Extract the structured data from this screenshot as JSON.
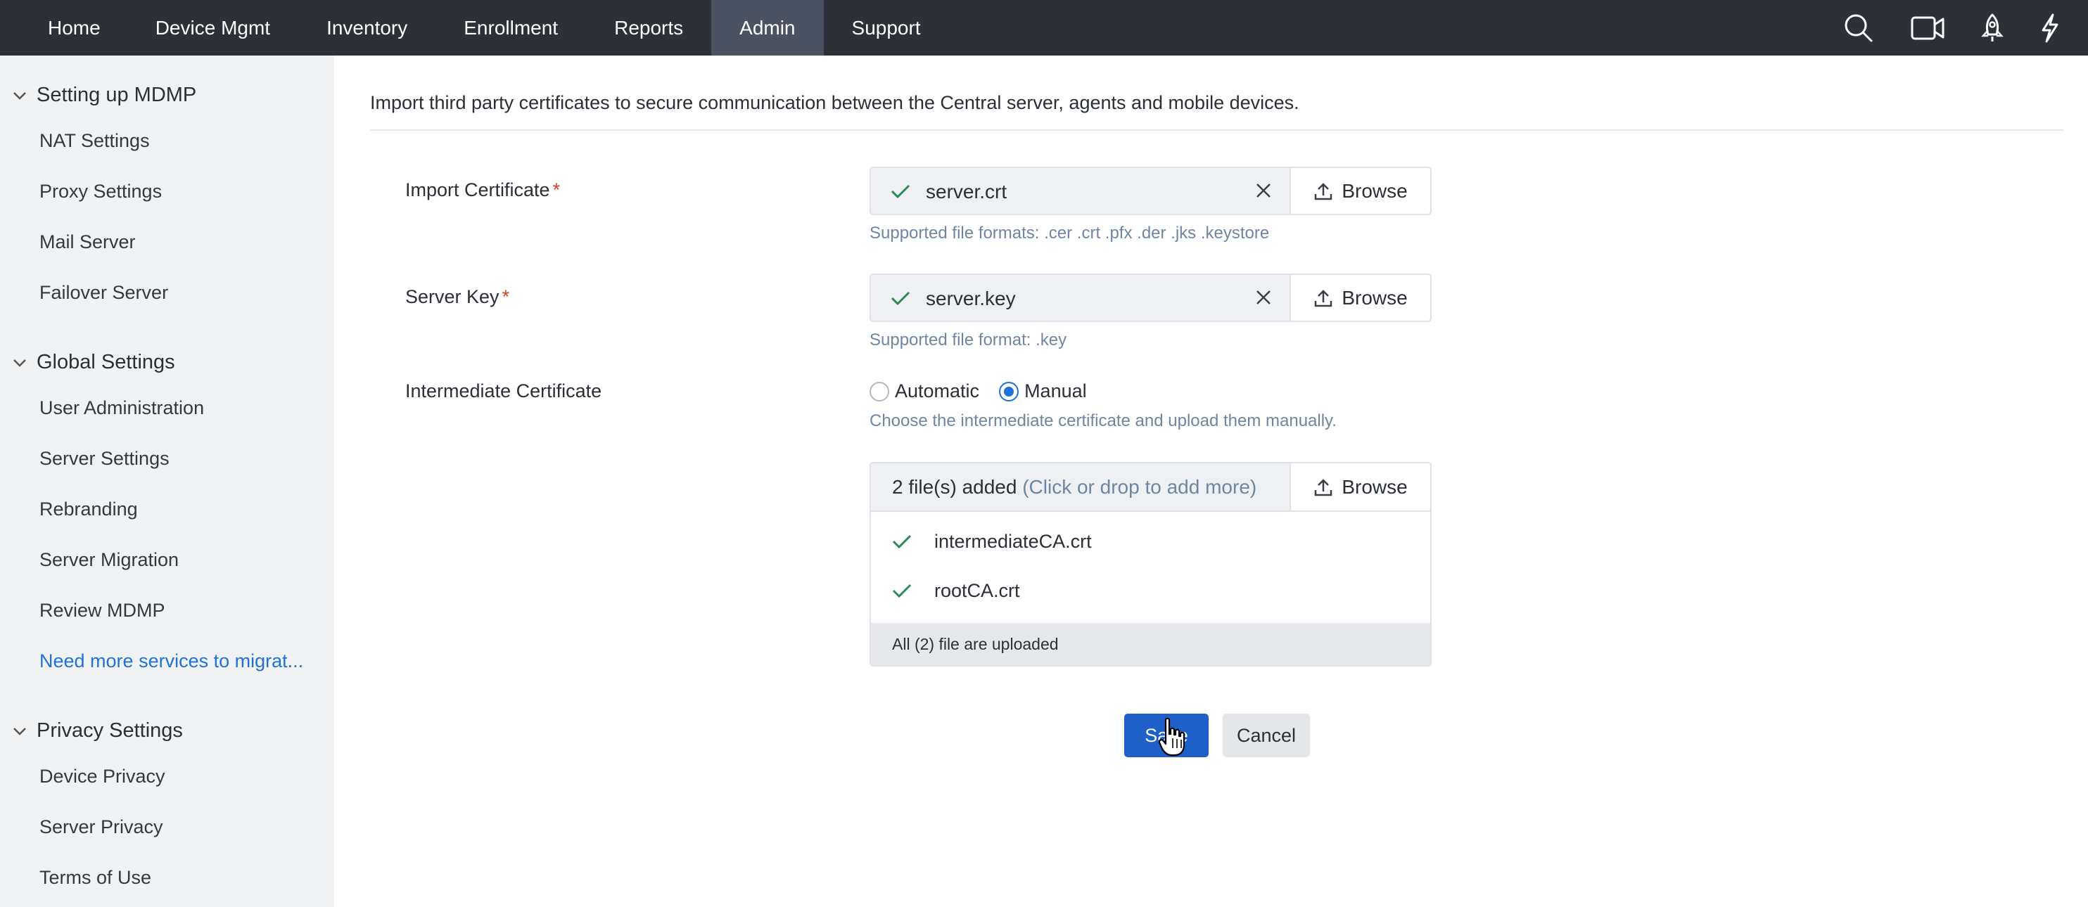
{
  "nav": {
    "items": [
      "Home",
      "Device Mgmt",
      "Inventory",
      "Enrollment",
      "Reports",
      "Admin",
      "Support"
    ],
    "active": "Admin",
    "icons": [
      "search-icon",
      "video-icon",
      "rocket-icon",
      "flash-icon"
    ]
  },
  "sidebar": {
    "groups": [
      {
        "title": "Setting up MDMP",
        "items": [
          "NAT Settings",
          "Proxy Settings",
          "Mail Server",
          "Failover Server"
        ]
      },
      {
        "title": "Global Settings",
        "items": [
          "User Administration",
          "Server Settings",
          "Rebranding",
          "Server Migration",
          "Review MDMP",
          "Need more services to migrat..."
        ]
      },
      {
        "title": "Privacy Settings",
        "items": [
          "Device Privacy",
          "Server Privacy",
          "Terms of Use"
        ]
      }
    ]
  },
  "main": {
    "intro": "Import third party certificates to secure communication between the Central server, agents and mobile devices.",
    "import_certificate": {
      "label": "Import Certificate",
      "required_mark": "*",
      "file": "server.crt",
      "browse": "Browse",
      "hint": "Supported file formats: .cer .crt .pfx .der .jks .keystore"
    },
    "server_key": {
      "label": "Server Key",
      "required_mark": "*",
      "file": "server.key",
      "browse": "Browse",
      "hint": "Supported file format: .key"
    },
    "intermediate": {
      "label": "Intermediate Certificate",
      "options": [
        "Automatic",
        "Manual"
      ],
      "selected": "Manual",
      "hint": "Choose the intermediate certificate and upload them manually.",
      "added_text": "2 file(s) added",
      "add_more": "(Click or drop to add more)",
      "browse": "Browse",
      "files": [
        "intermediateCA.crt",
        "rootCA.crt"
      ],
      "status": "All (2) file are uploaded"
    },
    "save": "Save",
    "cancel": "Cancel"
  },
  "colors": {
    "topbar": "#2d3037",
    "active_tab": "#4b5261",
    "primary": "#1f5fc9",
    "link": "#1f72d9",
    "check": "#2e8b57",
    "required": "#d1402b"
  }
}
